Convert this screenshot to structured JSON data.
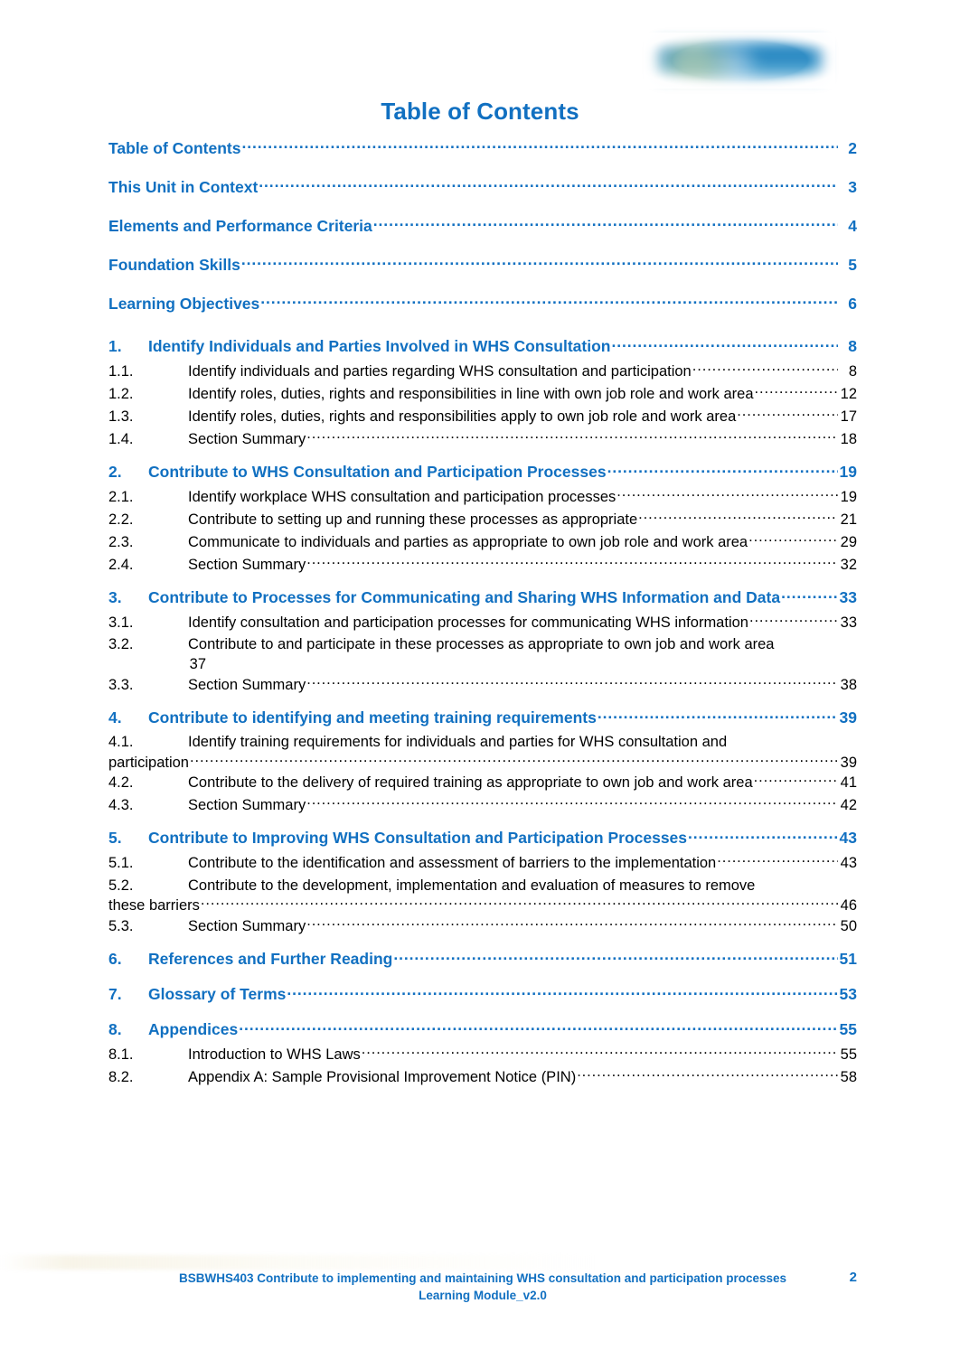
{
  "document": {
    "title": "Table of Contents",
    "accent_color": "#1170C1",
    "body_color": "#000000",
    "header_logo": "blurred-organisation-logo"
  },
  "toc": {
    "entries": [
      {
        "level": 0,
        "number": "",
        "label": "Table of Contents",
        "page": "2"
      },
      {
        "level": 0,
        "number": "",
        "label": "This Unit in Context",
        "page": "3"
      },
      {
        "level": 0,
        "number": "",
        "label": "Elements and Performance Criteria",
        "page": "4"
      },
      {
        "level": 0,
        "number": "",
        "label": "Foundation Skills",
        "page": "5"
      },
      {
        "level": 0,
        "number": "",
        "label": "Learning Objectives",
        "page": "6"
      },
      {
        "level": 1,
        "number": "1.",
        "label": "Identify Individuals and Parties Involved in WHS Consultation",
        "page": "8"
      },
      {
        "level": 2,
        "number": "1.1.",
        "label": "Identify individuals and parties regarding WHS consultation and participation",
        "page": "8"
      },
      {
        "level": 2,
        "number": "1.2.",
        "label": "Identify roles, duties, rights and responsibilities in line with own job role and work area",
        "page": "12"
      },
      {
        "level": 2,
        "number": "1.3.",
        "label": "Identify roles, duties, rights and responsibilities apply to own job role and work area",
        "page": "17"
      },
      {
        "level": 2,
        "number": "1.4.",
        "label": "Section Summary",
        "page": "18"
      },
      {
        "level": 1,
        "number": "2.",
        "label": "Contribute to WHS Consultation and Participation Processes",
        "page": "19"
      },
      {
        "level": 2,
        "number": "2.1.",
        "label": "Identify workplace WHS consultation and participation processes",
        "page": "19"
      },
      {
        "level": 2,
        "number": "2.2.",
        "label": "Contribute to setting up and running these processes as appropriate",
        "page": "21"
      },
      {
        "level": 2,
        "number": "2.3.",
        "label": "Communicate to individuals and parties as appropriate to own job role and work area",
        "page": "29"
      },
      {
        "level": 2,
        "number": "2.4.",
        "label": "Section Summary",
        "page": "32"
      },
      {
        "level": 1,
        "number": "3.",
        "label": "Contribute to Processes for Communicating and Sharing WHS Information and Data",
        "page": "33"
      },
      {
        "level": 2,
        "number": "3.1.",
        "label": "Identify consultation and participation processes for communicating WHS information",
        "page": "33"
      },
      {
        "level": 2,
        "number": "3.2.",
        "label": "Contribute to and participate in these processes as appropriate to own job and work area",
        "page": "37",
        "wrapped": "number-only"
      },
      {
        "level": 2,
        "number": "3.3.",
        "label": "Section Summary",
        "page": "38"
      },
      {
        "level": 1,
        "number": "4.",
        "label": "Contribute to identifying and meeting training requirements",
        "page": "39"
      },
      {
        "level": 2,
        "number": "4.1.",
        "label": "Identify training requirements for individuals and parties for WHS consultation and",
        "page": "39",
        "wrapped": "left",
        "continuation": "participation"
      },
      {
        "level": 2,
        "number": "4.2.",
        "label": "Contribute to the delivery of required training as appropriate to own job and work area",
        "page": "41"
      },
      {
        "level": 2,
        "number": "4.3.",
        "label": "Section Summary",
        "page": "42"
      },
      {
        "level": 1,
        "number": "5.",
        "label": "Contribute to Improving WHS Consultation and Participation Processes",
        "page": "43"
      },
      {
        "level": 2,
        "number": "5.1.",
        "label": "Contribute to the identification and assessment of barriers to the implementation",
        "page": "43"
      },
      {
        "level": 2,
        "number": "5.2.",
        "label": "Contribute to the development, implementation and evaluation of measures to remove",
        "page": "46",
        "wrapped": "left",
        "continuation": "these barriers"
      },
      {
        "level": 2,
        "number": "5.3.",
        "label": "Section Summary",
        "page": "50"
      },
      {
        "level": 1,
        "number": "6.",
        "label": "References and Further Reading",
        "page": "51"
      },
      {
        "level": 1,
        "number": "7.",
        "label": "Glossary of Terms",
        "page": "53"
      },
      {
        "level": 1,
        "number": "8.",
        "label": "Appendices",
        "page": "55"
      },
      {
        "level": 2,
        "number": "8.1.",
        "label": "Introduction to WHS Laws",
        "page": "55"
      },
      {
        "level": 2,
        "number": "8.2.",
        "label": "Appendix A: Sample Provisional Improvement Notice (PIN)",
        "page": "58"
      }
    ]
  },
  "footer": {
    "line1": "BSBWHS403 Contribute to implementing and maintaining WHS consultation and participation processes",
    "line2": "Learning Module_v2.0",
    "page_number": "2"
  }
}
